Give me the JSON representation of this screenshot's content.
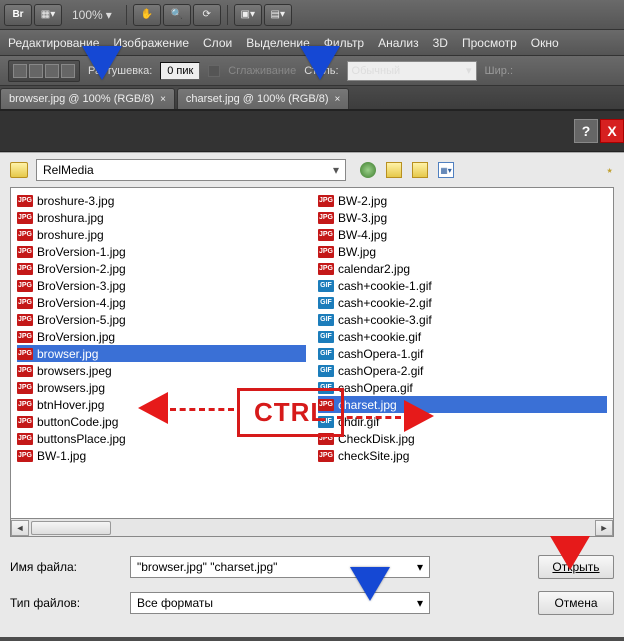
{
  "toolbar": {
    "br": "Br",
    "zoom": "100%",
    "zoom_caret": "▾"
  },
  "menu": {
    "edit": "Редактирование",
    "image": "Изображение",
    "layers": "Слои",
    "select": "Выделение",
    "filter": "Фильтр",
    "analysis": "Анализ",
    "threeD": "3D",
    "view": "Просмотр",
    "window": "Окно"
  },
  "options": {
    "feather_label": "Растушевка:",
    "feather_value": "0 пик",
    "antialias_label": "Сглаживание",
    "style_label": "Стиль:",
    "style_value": "Обычный",
    "width_label": "Шир.:"
  },
  "tabs": {
    "t1": "browser.jpg @ 100% (RGB/8)",
    "t2": "charset.jpg @ 100% (RGB/8)",
    "close": "×"
  },
  "dialog": {
    "help": "?",
    "close": "X",
    "folder": "RelMedia",
    "filename_label": "Имя файла:",
    "filename_value": "\"browser.jpg\" \"charset.jpg\"",
    "filetype_label": "Тип файлов:",
    "filetype_value": "Все форматы",
    "open": "Открыть",
    "cancel": "Отмена",
    "dd": "▾",
    "star": "⋆"
  },
  "annotation": {
    "ctrl": "CTRL"
  },
  "files_left": [
    {
      "name": "broshure-3.jpg",
      "type": "jpg"
    },
    {
      "name": "broshura.jpg",
      "type": "jpg"
    },
    {
      "name": "broshure.jpg",
      "type": "jpg"
    },
    {
      "name": "BroVersion-1.jpg",
      "type": "jpg"
    },
    {
      "name": "BroVersion-2.jpg",
      "type": "jpg"
    },
    {
      "name": "BroVersion-3.jpg",
      "type": "jpg"
    },
    {
      "name": "BroVersion-4.jpg",
      "type": "jpg"
    },
    {
      "name": "BroVersion-5.jpg",
      "type": "jpg"
    },
    {
      "name": "BroVersion.jpg",
      "type": "jpg"
    },
    {
      "name": "browser.jpg",
      "type": "jpg",
      "selected": true
    },
    {
      "name": "browsers.jpeg",
      "type": "jpg"
    },
    {
      "name": "browsers.jpg",
      "type": "jpg"
    },
    {
      "name": "btnHover.jpg",
      "type": "jpg"
    },
    {
      "name": "buttonCode.jpg",
      "type": "jpg"
    },
    {
      "name": "buttonsPlace.jpg",
      "type": "jpg"
    },
    {
      "name": "BW-1.jpg",
      "type": "jpg"
    }
  ],
  "files_right": [
    {
      "name": "BW-2.jpg",
      "type": "jpg"
    },
    {
      "name": "BW-3.jpg",
      "type": "jpg"
    },
    {
      "name": "BW-4.jpg",
      "type": "jpg"
    },
    {
      "name": "BW.jpg",
      "type": "jpg"
    },
    {
      "name": "calendar2.jpg",
      "type": "jpg"
    },
    {
      "name": "cash+cookie-1.gif",
      "type": "gif"
    },
    {
      "name": "cash+cookie-2.gif",
      "type": "gif"
    },
    {
      "name": "cash+cookie-3.gif",
      "type": "gif"
    },
    {
      "name": "cash+cookie.gif",
      "type": "gif"
    },
    {
      "name": "cashOpera-1.gif",
      "type": "gif"
    },
    {
      "name": "cashOpera-2.gif",
      "type": "gif"
    },
    {
      "name": "cashOpera.gif",
      "type": "gif"
    },
    {
      "name": "charset.jpg",
      "type": "jpg",
      "selected": true
    },
    {
      "name": "chdir.gif",
      "type": "gif"
    },
    {
      "name": "CheckDisk.jpg",
      "type": "jpg"
    },
    {
      "name": "checkSite.jpg",
      "type": "jpg"
    }
  ]
}
